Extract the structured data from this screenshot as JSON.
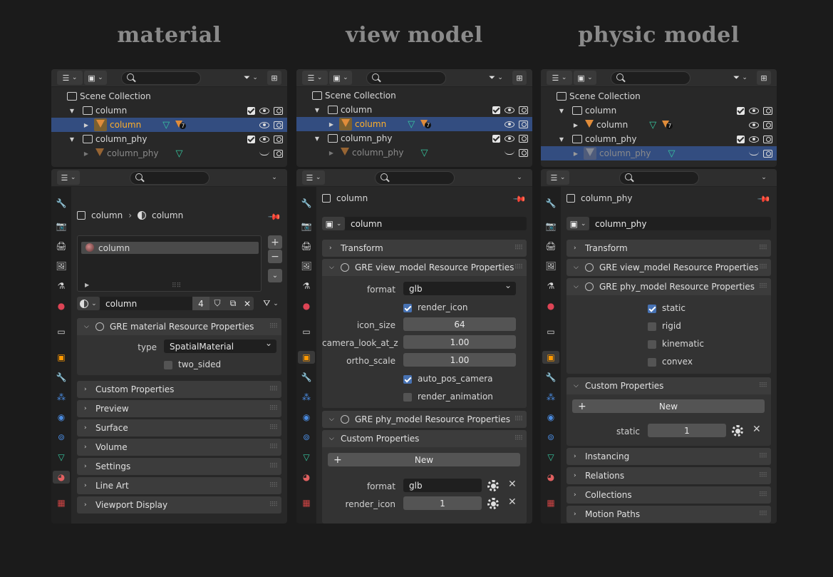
{
  "titles": [
    "material",
    "view model",
    "physic model"
  ],
  "icons": {
    "editor_type": "editor-type-icon",
    "display_mode": "display-mode-icon",
    "filter": "filter-icon",
    "new_collection": "new-collection-icon",
    "scene_collection": "scene-collection-icon",
    "collection": "collection-icon",
    "object": "mesh-object-icon",
    "mesh_data": "mesh-data-icon",
    "modifier": "modifier-icon",
    "visibility": "eye-icon",
    "render": "camera-icon",
    "exclude_checkbox": "checkbox-icon"
  },
  "colors": {
    "accent_selection": "#334d80",
    "selected_object_text": "#ffaf29",
    "checkbox_on": "#4772b3",
    "panel_bg": "#282828",
    "page_bg": "#1b1b1b"
  },
  "outliners": [
    {
      "scene_collection": "Scene Collection",
      "rows": [
        {
          "label": "column",
          "kind": "collection"
        },
        {
          "label": "column",
          "kind": "object",
          "selected": true,
          "modifier_count": "7"
        },
        {
          "label": "column_phy",
          "kind": "collection"
        },
        {
          "label": "column_phy",
          "kind": "object",
          "dim": true
        }
      ]
    },
    {
      "scene_collection": "Scene Collection",
      "rows": [
        {
          "label": "column",
          "kind": "collection"
        },
        {
          "label": "column",
          "kind": "object",
          "selected": true,
          "modifier_count": "7"
        },
        {
          "label": "column_phy",
          "kind": "collection"
        },
        {
          "label": "column_phy",
          "kind": "object",
          "dim": true
        }
      ]
    },
    {
      "scene_collection": "Scene Collection",
      "rows": [
        {
          "label": "column",
          "kind": "collection"
        },
        {
          "label": "column",
          "kind": "object",
          "modifier_count": "7"
        },
        {
          "label": "column_phy",
          "kind": "collection"
        },
        {
          "label": "column_phy",
          "kind": "object",
          "dim": true,
          "selected": true
        }
      ]
    }
  ],
  "material": {
    "path_object": "column",
    "path_material": "column",
    "slot_name": "column",
    "datablock_name": "column",
    "user_count": "4",
    "gre_panel": "GRE material Resource Properties",
    "type_label": "type",
    "type_value": "SpatialMaterial",
    "two_sided": "two_sided",
    "sections": [
      "Custom Properties",
      "Preview",
      "Surface",
      "Volume",
      "Settings",
      "Line Art",
      "Viewport Display"
    ]
  },
  "view_model": {
    "object_name": "column",
    "name_field": "column",
    "transform": "Transform",
    "gre_view": "GRE view_model Resource Properties",
    "format_label": "format",
    "format_value": "glb",
    "render_icon": "render_icon",
    "icon_size_label": "icon_size",
    "icon_size_value": "64",
    "camera_look_label": "camera_look_at_z",
    "camera_look_value": "1.00",
    "ortho_label": "ortho_scale",
    "ortho_value": "1.00",
    "auto_pos_camera": "auto_pos_camera",
    "render_animation": "render_animation",
    "gre_phy": "GRE phy_model Resource Properties",
    "custom_props": "Custom Properties",
    "new_btn": "New",
    "cp_format_label": "format",
    "cp_format_value": "glb",
    "cp_render_icon_label": "render_icon",
    "cp_render_icon_value": "1"
  },
  "physic_model": {
    "object_name": "column_phy",
    "name_field": "column_phy",
    "transform": "Transform",
    "gre_view": "GRE view_model Resource Properties",
    "gre_phy": "GRE phy_model Resource Properties",
    "static": "static",
    "rigid": "rigid",
    "kinematic": "kinematic",
    "convex": "convex",
    "custom_props": "Custom Properties",
    "new_btn": "New",
    "cp_static_label": "static",
    "cp_static_value": "1",
    "sections": [
      "Instancing",
      "Relations",
      "Collections",
      "Motion Paths"
    ]
  }
}
